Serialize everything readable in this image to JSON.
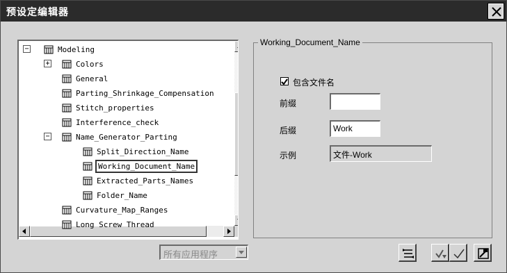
{
  "window": {
    "title": "预设定编辑器"
  },
  "tree": {
    "items": [
      {
        "label": "Modeling",
        "level": 0,
        "expander": "−"
      },
      {
        "label": "Colors",
        "level": 1,
        "expander": "+"
      },
      {
        "label": "General",
        "level": 1,
        "expander": ""
      },
      {
        "label": "Parting_Shrinkage_Compensation",
        "level": 1,
        "expander": ""
      },
      {
        "label": "Stitch_properties",
        "level": 1,
        "expander": ""
      },
      {
        "label": "Interference_check",
        "level": 1,
        "expander": ""
      },
      {
        "label": "Name_Generator_Parting",
        "level": 1,
        "expander": "−"
      },
      {
        "label": "Split_Direction_Name",
        "level": 2,
        "expander": ""
      },
      {
        "label": "Working_Document_Name",
        "level": 2,
        "expander": "",
        "selected": true
      },
      {
        "label": "Extracted_Parts_Names",
        "level": 2,
        "expander": ""
      },
      {
        "label": "Folder_Name",
        "level": 2,
        "expander": ""
      },
      {
        "label": "Curvature_Map_Ranges",
        "level": 1,
        "expander": ""
      },
      {
        "label": "Long Screw Thread",
        "level": 1,
        "expander": ""
      }
    ]
  },
  "group": {
    "title": "Working_Document_Name",
    "include_filename_label": "包含文件名",
    "include_filename_checked": true,
    "prefix_label": "前缀",
    "prefix_value": "",
    "suffix_label": "后缀",
    "suffix_value": "Work",
    "example_label": "示例",
    "example_value": "文件-Work"
  },
  "footer": {
    "app_filter_value": "所有应用程序",
    "buttons": [
      "import-export-icon",
      "reset-icon",
      "apply-check-icon",
      "save-icon"
    ]
  }
}
